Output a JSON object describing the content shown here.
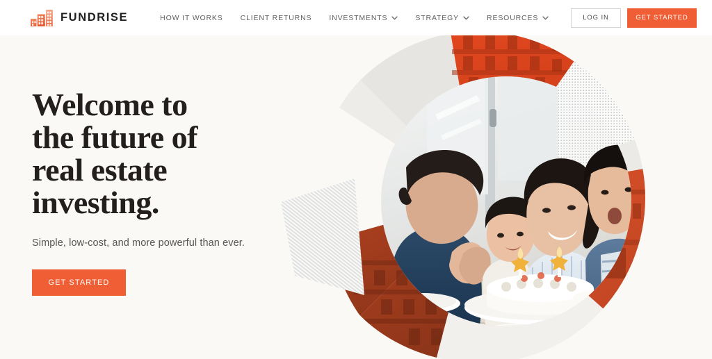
{
  "brand": {
    "name": "FUNDRISE",
    "logo_icon": "buildings-logo-icon",
    "accent_color": "#ef5e34",
    "text_color": "#231f1e",
    "page_background": "#faf9f6",
    "header_background": "#ffffff"
  },
  "header": {
    "nav": [
      {
        "label": "HOW IT WORKS",
        "has_dropdown": false
      },
      {
        "label": "CLIENT RETURNS",
        "has_dropdown": false
      },
      {
        "label": "INVESTMENTS",
        "has_dropdown": true
      },
      {
        "label": "STRATEGY",
        "has_dropdown": true
      },
      {
        "label": "RESOURCES",
        "has_dropdown": true
      }
    ],
    "login_label": "LOG IN",
    "get_started_label": "GET STARTED"
  },
  "hero": {
    "headline_lines": [
      "Welcome to",
      "the future of",
      "real estate",
      "investing."
    ],
    "subheadline": "Simple, low-cost, and more powerful than ever.",
    "cta_label": "GET STARTED",
    "artwork": {
      "description": "Circular collage: outer ring split into wedges of grey, dotted texture, diagonal-line texture and orange apartment-building photos, around a central circular photo of a family celebrating a birthday with a cake",
      "ring_colors": {
        "grey_solid": "#e3e2df",
        "light_grey": "#ececea",
        "dot_texture": "#f4f4f2",
        "line_texture": "#f0efed",
        "orange_building_top": "#d8401c",
        "orange_building_right": "#d4512c",
        "brick_building_bottom": "#a8401f"
      },
      "center_photo": {
        "subjects": [
          "man in blue polo clapping",
          "toddler girl laughing",
          "grandmother in striped shirt",
          "boy in denim shirt"
        ],
        "objects": [
          "white birthday cake",
          "star candles",
          "white plates",
          "wooden table",
          "window"
        ]
      }
    }
  }
}
